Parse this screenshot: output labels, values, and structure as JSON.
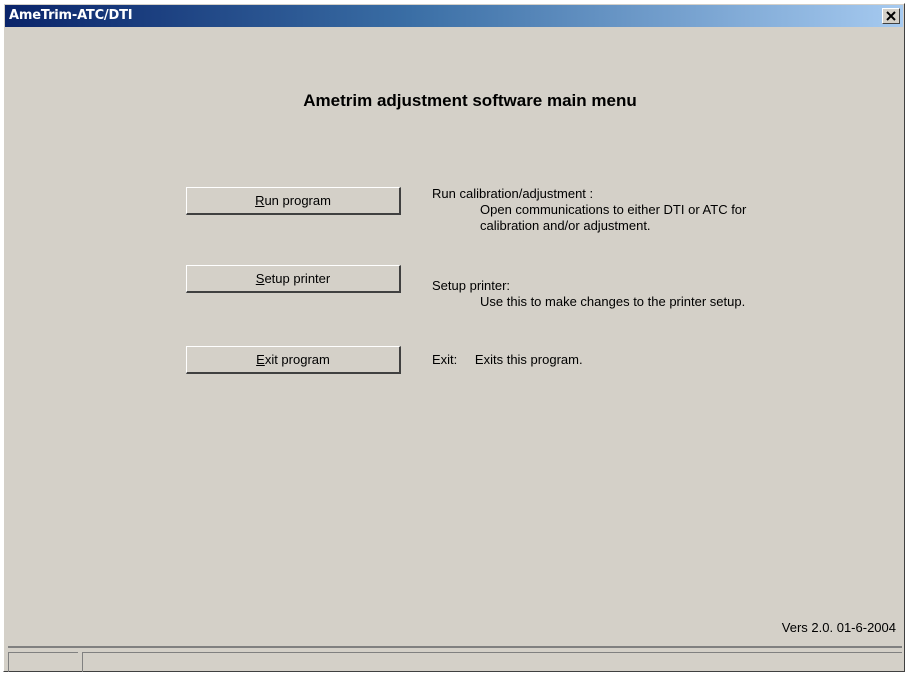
{
  "window": {
    "title": "AmeTrim-ATC/DTI",
    "close_glyph": "✕"
  },
  "main": {
    "heading": "Ametrim adjustment software main menu",
    "buttons": [
      {
        "mnemonic": "R",
        "rest": "un program"
      },
      {
        "mnemonic": "S",
        "rest": "etup printer"
      },
      {
        "mnemonic": "E",
        "rest": "xit program"
      }
    ],
    "descriptions": {
      "run": {
        "title": "Run calibration/adjustment :",
        "line1": "Open communications to either DTI or ATC for",
        "line2": "calibration and/or adjustment."
      },
      "setup": {
        "title": "Setup printer:",
        "line1": "Use this to make changes to the printer setup."
      },
      "exit": {
        "label": "Exit:",
        "text": "Exits this program."
      }
    },
    "version": "Vers 2.0. 01-6-2004"
  },
  "statusbar": {
    "panels": [
      "",
      ""
    ]
  }
}
